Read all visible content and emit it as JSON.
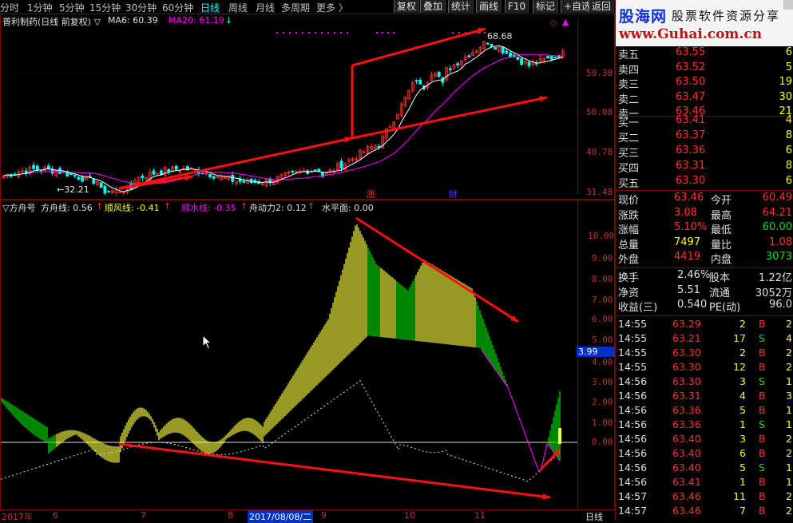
{
  "toolbar": {
    "periods": [
      "分时",
      "1分钟",
      "5分钟",
      "15分钟",
      "30分钟",
      "60分钟",
      "日线",
      "周线",
      "月线",
      "多周期",
      "更多 〉"
    ],
    "active_period": "日线",
    "buttons": [
      "复权",
      "叠加",
      "统计",
      "画线",
      "F10",
      "标记",
      "+自选",
      "返回"
    ]
  },
  "main_chart": {
    "header_stock": "普利制药(日线 前复权) ▽",
    "ma6_label": "MA6: 60.39",
    "ma20_label": "MA20: 61.19",
    "ma20_arrow": "↓",
    "high_label": "68.68",
    "low_label": "←32.21",
    "marker_zhang": "涨",
    "marker_cai": "财",
    "y_labels": [
      "59.38",
      "50.08",
      "40.78",
      "31.48"
    ],
    "colors": {
      "up": "#ff3030",
      "down": "#00ffff",
      "ma6": "#ffffff",
      "ma20": "#ff00ff",
      "arrow": "#ff1010"
    }
  },
  "indicator": {
    "name": "▽方舟号",
    "fangzhou_label": "方舟线: 0.56",
    "fangzhou_arrow": "↑",
    "shunfeng_label": "顺风线: -0.41",
    "shunfeng_arrow": "↑",
    "shunshui_label": "顺水线: -0.35",
    "shunshui_arrow": "↑",
    "dongli_label": "舟动力2: 0.12",
    "dongli_arrow": "↑",
    "shuiping_label": "水平面: 0.00",
    "current_value": "3.99",
    "y_labels": [
      "10.00",
      "9.00",
      "8.00",
      "7.00",
      "6.00",
      "5.00",
      "4.00",
      "3.00",
      "2.00",
      "1.00",
      "0.00"
    ]
  },
  "x_axis": {
    "labels": [
      "2017年",
      "6",
      "7",
      "8",
      "2017/08/08/二",
      "9",
      "10",
      "11"
    ],
    "period_label": "日线"
  },
  "logo": {
    "brand": "股海网",
    "tagline": "股票软件资源分享",
    "url": "www.Guhai.com.cn"
  },
  "order_book": {
    "asks": [
      {
        "label": "卖五",
        "price": "63.55",
        "vol": "6"
      },
      {
        "label": "卖四",
        "price": "63.52",
        "vol": "5"
      },
      {
        "label": "卖三",
        "price": "63.50",
        "vol": "19"
      },
      {
        "label": "卖二",
        "price": "63.47",
        "vol": "30"
      },
      {
        "label": "卖一",
        "price": "63.46",
        "vol": "21"
      }
    ],
    "bids": [
      {
        "label": "买一",
        "price": "63.41",
        "vol": "4"
      },
      {
        "label": "买二",
        "price": "63.37",
        "vol": "8"
      },
      {
        "label": "买三",
        "price": "63.36",
        "vol": "6"
      },
      {
        "label": "买四",
        "price": "63.31",
        "vol": "8"
      },
      {
        "label": "买五",
        "price": "63.30",
        "vol": "6"
      }
    ]
  },
  "quote": [
    {
      "l1": "现价",
      "v1": "63.46",
      "c1": "red",
      "l2": "今开",
      "v2": "60.49",
      "c2": "red"
    },
    {
      "l1": "涨跌",
      "v1": "3.08",
      "c1": "red",
      "l2": "最高",
      "v2": "64.21",
      "c2": "red"
    },
    {
      "l1": "涨幅",
      "v1": "5.10%",
      "c1": "red",
      "l2": "最低",
      "v2": "60.00",
      "c2": "grn"
    },
    {
      "l1": "总量",
      "v1": "7497",
      "c1": "yel",
      "l2": "量比",
      "v2": "1.08",
      "c2": "red"
    },
    {
      "l1": "外盘",
      "v1": "4419",
      "c1": "red",
      "l2": "内盘",
      "v2": "3073",
      "c2": "grn"
    }
  ],
  "fundamentals": [
    {
      "l1": "换手",
      "v1": "2.46%",
      "l2": "股本",
      "v2": "1.22亿"
    },
    {
      "l1": "净资",
      "v1": "5.51",
      "l2": "流通",
      "v2": "3052万"
    },
    {
      "l1": "收益(三)",
      "v1": "0.540",
      "l2": "PE(动)",
      "v2": "96.0"
    }
  ],
  "ticks": [
    {
      "time": "14:55",
      "price": "63.29",
      "vol": "2",
      "side": "B",
      "n": "2"
    },
    {
      "time": "14:55",
      "price": "63.21",
      "vol": "17",
      "side": "S",
      "n": "4"
    },
    {
      "time": "14:55",
      "price": "63.30",
      "vol": "2",
      "side": "B",
      "n": "2"
    },
    {
      "time": "14:55",
      "price": "63.30",
      "vol": "12",
      "side": "B",
      "n": "2"
    },
    {
      "time": "14:56",
      "price": "63.30",
      "vol": "3",
      "side": "S",
      "n": "1"
    },
    {
      "time": "14:56",
      "price": "63.31",
      "vol": "4",
      "side": "B",
      "n": "3"
    },
    {
      "time": "14:56",
      "price": "63.36",
      "vol": "5",
      "side": "B",
      "n": "1"
    },
    {
      "time": "14:56",
      "price": "63.36",
      "vol": "1",
      "side": "S",
      "n": "1"
    },
    {
      "time": "14:56",
      "price": "63.40",
      "vol": "3",
      "side": "B",
      "n": "2"
    },
    {
      "time": "14:56",
      "price": "63.40",
      "vol": "6",
      "side": "B",
      "n": "2"
    },
    {
      "time": "14:56",
      "price": "63.40",
      "vol": "5",
      "side": "S",
      "n": "1"
    },
    {
      "time": "14:56",
      "price": "63.41",
      "vol": "1",
      "side": "B",
      "n": "1"
    },
    {
      "time": "14:57",
      "price": "63.46",
      "vol": "11",
      "side": "B",
      "n": "2"
    },
    {
      "time": "14:57",
      "price": "63.46",
      "vol": "7",
      "side": "B",
      "n": "2"
    }
  ]
}
